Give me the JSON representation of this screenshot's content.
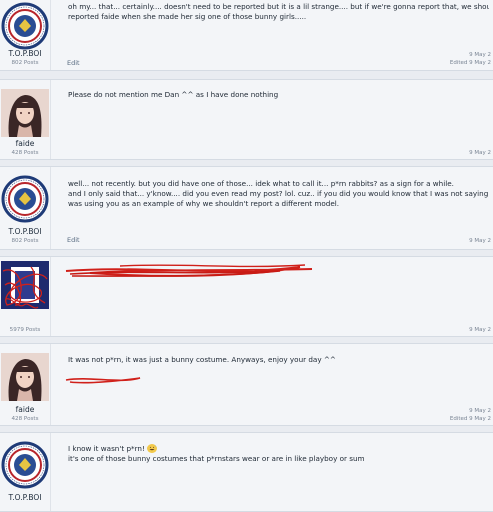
{
  "posts": [
    {
      "author": "T.O.P.BOI",
      "posts_count": "802 Posts",
      "lines": [
        "oh my... that... certainly.... doesn't need to be reported but it is a lil strange.... but if we're gonna report that, we should have",
        "reported faide when she made her sig one of those bunny girls....."
      ],
      "edit_label": "Edit",
      "date": "9 May 2",
      "edited": "Edited 9 May 2"
    },
    {
      "author": "faide",
      "posts_count": "428 Posts",
      "lines": [
        "Please do not mention me Dan ^^ as I have done nothing"
      ],
      "date": "9 May 2"
    },
    {
      "author": "T.O.P.BOI",
      "posts_count": "802 Posts",
      "lines": [
        "well... not recently. but you did have one of those... idek what to call it... p*rn rabbits? as a sign for a while.",
        "and I only said that... y'know.... did you even read my post? lol. cuz.. if you did you would know that I was not saying to report",
        "was using you as an example of why we shouldn't report a different model."
      ],
      "edit_label": "Edit",
      "date": "9 May 2"
    },
    {
      "author": "",
      "posts_count": "5979 Posts",
      "lines": [],
      "date": "9 May 2"
    },
    {
      "author": "faide",
      "posts_count": "428 Posts",
      "lines": [
        "It was not p*rn, it was just a bunny costume. Anyways, enjoy your day ^^"
      ],
      "date": "9 May 2",
      "edited": "Edited 9 May 2"
    },
    {
      "author": "T.O.P.BOI",
      "posts_count": "",
      "lines": [
        "I know it wasn't p*rn!",
        "it's one of those bunny costumes that p*rnstars wear or are in like playboy or sum"
      ]
    }
  ],
  "colors": {
    "page_bg": "#e9ecf1",
    "post_bg": "#f3f5f8",
    "scribble": "#d0201a"
  },
  "icons": [
    "seal-avatar-icon",
    "girl-avatar-icon",
    "grinning-sweat-emoji-icon"
  ]
}
